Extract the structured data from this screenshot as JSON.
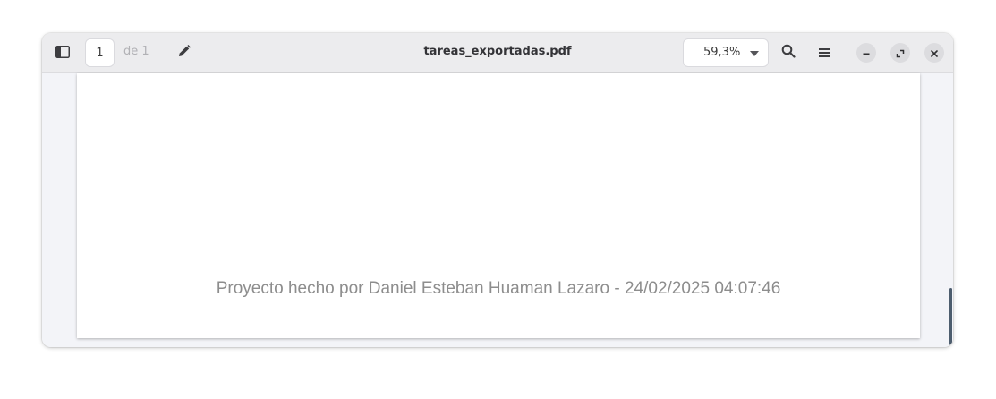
{
  "window": {
    "title": "tareas_exportadas.pdf"
  },
  "header": {
    "current_page": "1",
    "page_of": "de 1",
    "zoom": "59,3%",
    "icons": {
      "sidebar": "sidebar-toggle-icon",
      "edit": "pencil-icon",
      "search": "search-icon",
      "menu": "hamburger-menu-icon",
      "minimize": "minimize-icon",
      "maximize": "maximize-icon",
      "close": "close-icon"
    }
  },
  "document": {
    "footer": "Proyecto hecho por Daniel Esteban Huaman Lazaro - 24/02/2025 04:07:46"
  },
  "colors": {
    "headerbar": "#ececee",
    "canvas": "#f3f4f8",
    "page": "#ffffff",
    "footer_text": "#8d8d8d",
    "scrollbar": "#4d5d6e"
  }
}
